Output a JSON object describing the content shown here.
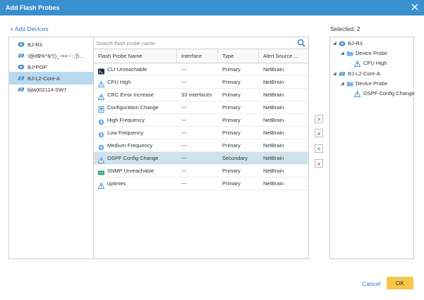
{
  "dialog": {
    "title": "Add Flash Probes"
  },
  "toolbar": {
    "add_devices": "+ Add Devices",
    "selected_label": "Selected: 2"
  },
  "devices": [
    {
      "label": "BJ-R3",
      "icon": "router-icon",
      "selected": false
    },
    {
      "label": "!@#$%^&*()_-=+~`:;'[\\...",
      "icon": "switch-icon",
      "selected": false
    },
    {
      "label": "BJ*POP",
      "icon": "router-icon",
      "selected": false
    },
    {
      "label": "BJ-L2-Core-A",
      "icon": "switch-icon",
      "selected": true
    },
    {
      "label": "bjta002114-SW7",
      "icon": "switch-icon",
      "selected": false
    }
  ],
  "search": {
    "placeholder": "Search flash probe name",
    "value": ""
  },
  "table": {
    "headers": [
      "Flash Probe Name",
      "Interface",
      "Type",
      "Alert Source ..."
    ],
    "rows": [
      {
        "name": "CLI Unreachable",
        "icon": "cli-icon",
        "interface": "---",
        "type": "Primary",
        "source": "NetBrain",
        "selected": false
      },
      {
        "name": "CPU High",
        "icon": "alert-triangle-icon",
        "interface": "---",
        "type": "Primary",
        "source": "NetBrain",
        "selected": false
      },
      {
        "name": "CRC Error Increase",
        "icon": "alert-triangle-icon",
        "interface": "33 Interfaces",
        "type": "Primary",
        "source": "NetBrain",
        "selected": false
      },
      {
        "name": "Configuration Change",
        "icon": "config-icon",
        "interface": "---",
        "type": "Primary",
        "source": "NetBrain",
        "selected": false
      },
      {
        "name": "High Frequency",
        "icon": "clock-icon",
        "interface": "---",
        "type": "Primary",
        "source": "NetBrain",
        "selected": false
      },
      {
        "name": "Low Frequency",
        "icon": "clock-icon",
        "interface": "---",
        "type": "Primary",
        "source": "NetBrain",
        "selected": false
      },
      {
        "name": "Medium Frequency",
        "icon": "clock-icon",
        "interface": "---",
        "type": "Primary",
        "source": "NetBrain",
        "selected": false
      },
      {
        "name": "OSPF Config Change",
        "icon": "alert-triangle-icon",
        "interface": "---",
        "type": "Secondary",
        "source": "NetBrain",
        "selected": true
      },
      {
        "name": "SNMP Unreachable",
        "icon": "snmp-icon",
        "interface": "---",
        "type": "Primary",
        "source": "NetBrain",
        "selected": false
      },
      {
        "name": "uptimes",
        "icon": "alert-triangle-icon",
        "interface": "---",
        "type": "Primary",
        "source": "NetBrain",
        "selected": false
      }
    ]
  },
  "move_buttons": [
    {
      "label": ">",
      "name": "move-right-button"
    },
    {
      "label": "»",
      "name": "move-all-right-button"
    },
    {
      "label": "<",
      "name": "move-left-button"
    },
    {
      "label": "«",
      "name": "move-all-left-button"
    }
  ],
  "selected_tree": [
    {
      "label": "BJ-R3",
      "icon": "router-icon",
      "level": 0
    },
    {
      "label": "Device Probe",
      "icon": "folder-icon",
      "level": 1
    },
    {
      "label": "CPU High",
      "icon": "alert-triangle-icon",
      "level": 2
    },
    {
      "label": "BJ-L2-Core-A",
      "icon": "switch-icon",
      "level": 0
    },
    {
      "label": "Device Probe",
      "icon": "folder-icon",
      "level": 1
    },
    {
      "label": "OSPF Config Change",
      "icon": "alert-triangle-icon",
      "level": 2
    }
  ],
  "footer": {
    "cancel": "Cancel",
    "ok": "OK"
  },
  "colors": {
    "title_bar": "#3a8fcf",
    "accent_link": "#2a78c2",
    "ok_button": "#f6c646",
    "selection": "#b8d9f0"
  }
}
